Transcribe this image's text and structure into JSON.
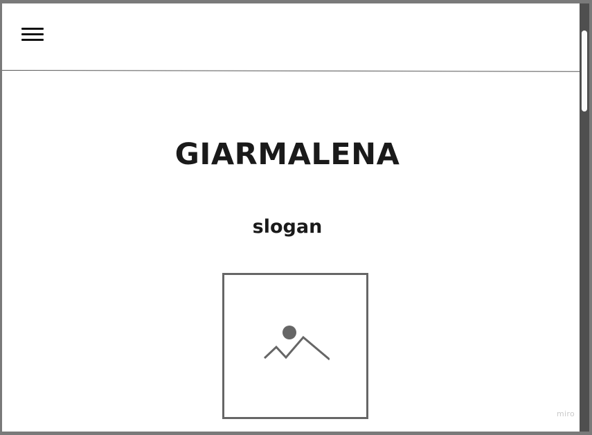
{
  "header": {
    "menu_icon": "hamburger-menu-icon"
  },
  "hero": {
    "title": "GIARMALENA",
    "slogan": "slogan",
    "image_icon": "image-placeholder-icon"
  },
  "watermark": {
    "text": "miro"
  },
  "colors": {
    "frame": "#7a7a7a",
    "page_background": "#ffffff",
    "text": "#1a1a1a",
    "placeholder_border": "#666666",
    "scrollbar_track": "#4f4f4f",
    "scrollbar_thumb": "#fafafa"
  }
}
